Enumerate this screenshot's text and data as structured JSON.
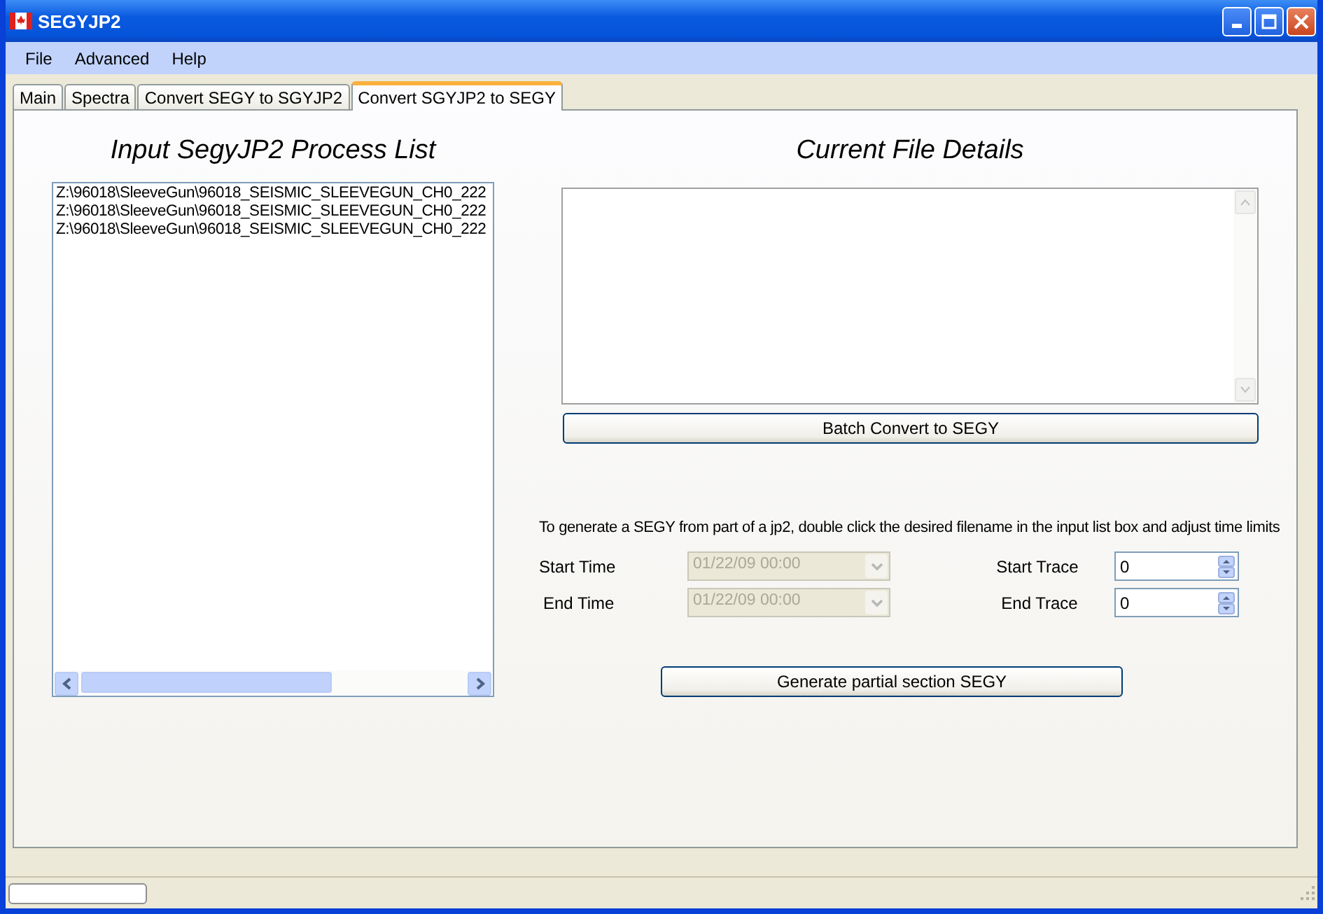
{
  "window": {
    "title": "SEGYJP2"
  },
  "menu": [
    "File",
    "Advanced",
    "Help"
  ],
  "tabs": [
    {
      "label": "Main",
      "selected": false
    },
    {
      "label": "Spectra",
      "selected": false
    },
    {
      "label": "Convert SEGY to SGYJP2",
      "selected": false
    },
    {
      "label": "Convert SGYJP2 to SEGY",
      "selected": true
    }
  ],
  "input_list": {
    "heading": "Input SegyJP2 Process List",
    "items": [
      "Z:\\96018\\SleeveGun\\96018_SEISMIC_SLEEVEGUN_CH0_222",
      "Z:\\96018\\SleeveGun\\96018_SEISMIC_SLEEVEGUN_CH0_222",
      "Z:\\96018\\SleeveGun\\96018_SEISMIC_SLEEVEGUN_CH0_222"
    ]
  },
  "details": {
    "heading": "Current File Details",
    "batch_button": "Batch Convert to SEGY"
  },
  "partial": {
    "instructions": "To generate a SEGY from part of a jp2, double click the desired filename in the input list box and adjust time limits",
    "start_time": {
      "label": "Start Time",
      "value": "01/22/09 00:00",
      "disabled": true
    },
    "end_time": {
      "label": "End Time",
      "value": "01/22/09 00:00",
      "disabled": true
    },
    "start_trace": {
      "label": "Start Trace",
      "value": "0"
    },
    "end_trace": {
      "label": "End Trace",
      "value": "0"
    },
    "button": "Generate partial section  SEGY"
  },
  "status_bar": {
    "progress": {
      "level": 0
    }
  }
}
